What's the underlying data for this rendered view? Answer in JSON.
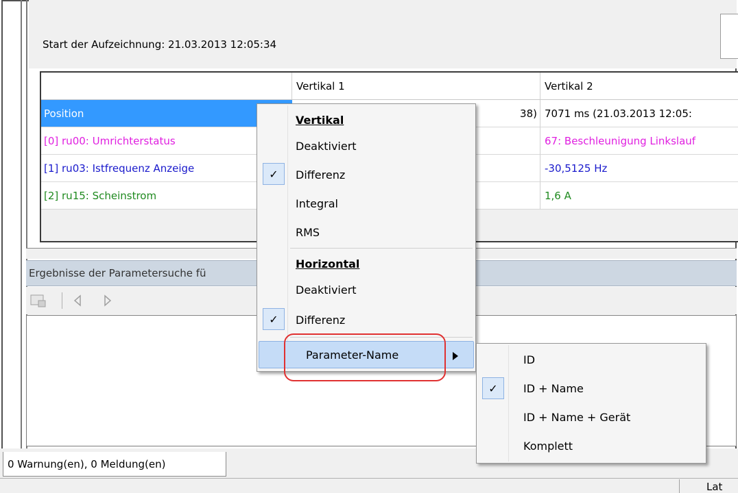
{
  "recording": {
    "start_label": "Start der Aufzeichnung: 21.03.2013 12:05:34"
  },
  "table": {
    "headers": [
      "",
      "Vertikal 1",
      "Vertikal 2"
    ],
    "rows": [
      {
        "name": "Position",
        "v1": "38)",
        "v2": "7071 ms (21.03.2013 12:05:",
        "color": "#ffffff"
      },
      {
        "name": "[0] ru00: Umrichterstatus",
        "v1": "",
        "v2": "67: Beschleunigung Linkslauf",
        "color": "#e020e0"
      },
      {
        "name": "[1] ru03: Istfrequenz Anzeige",
        "v1": "",
        "v2": "-30,5125 Hz",
        "color": "#1a1acc"
      },
      {
        "name": "[2] ru15: Scheinstrom",
        "v1": "",
        "v2": "1,6 A",
        "color": "#1f8a1f"
      }
    ]
  },
  "search_panel": {
    "title": "Ergebnisse der Parametersuche fü"
  },
  "status_tab": {
    "label": "0 Warnung(en), 0 Meldung(en)"
  },
  "bottom_right_text": "Lat",
  "context_menu": {
    "vertical_header": "Vertikal",
    "vertical_items": [
      "Deaktiviert",
      "Differenz",
      "Integral",
      "RMS"
    ],
    "horizontal_header": "Horizontal",
    "horizontal_items": [
      "Deaktiviert",
      "Differenz"
    ],
    "submenu_trigger": "Parameter-Name",
    "checked": {
      "vertical": "Differenz",
      "horizontal": "Differenz"
    }
  },
  "submenu": {
    "items": [
      "ID",
      "ID + Name",
      "ID + Name + Gerät",
      "Komplett"
    ],
    "checked": "ID + Name"
  },
  "colors": {
    "selection": "#3399ff",
    "highlight_ring": "#e03030",
    "menu_hover": "#c5dcf7"
  }
}
